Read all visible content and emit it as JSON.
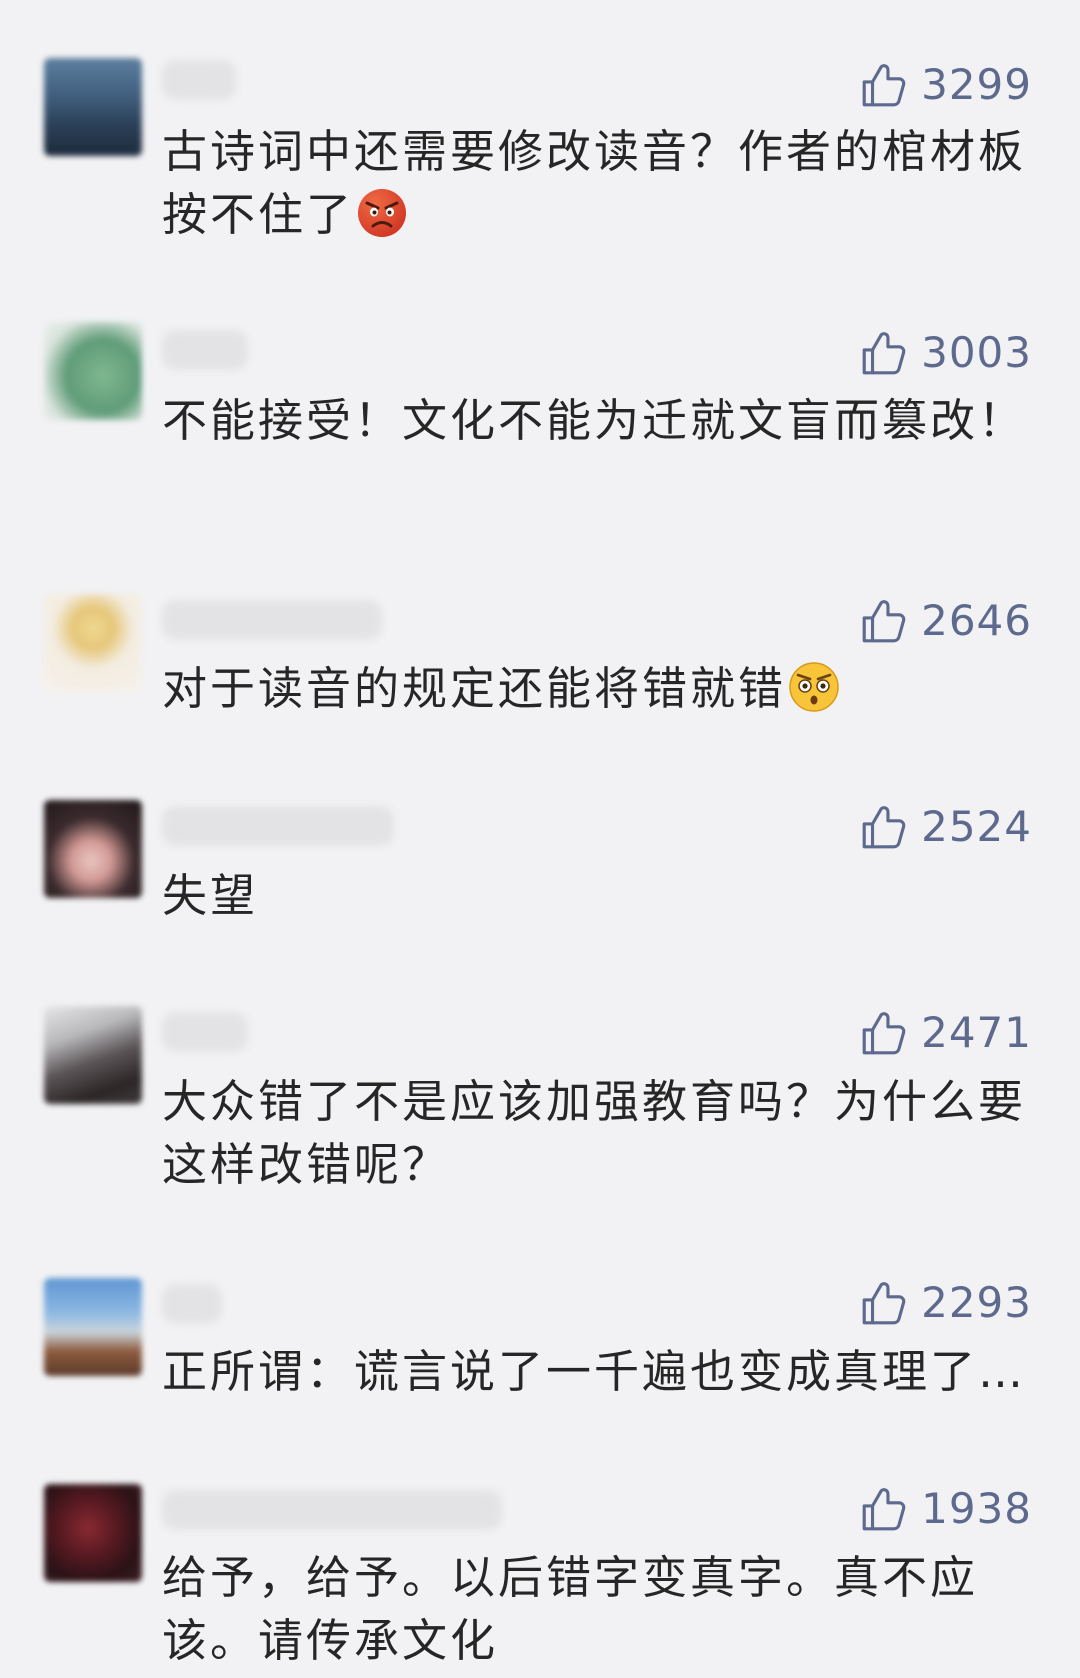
{
  "comments": [
    {
      "likes": "3299",
      "text": "古诗词中还需要修改读音？作者的棺材板按不住了",
      "emoji": "angry-face-icon"
    },
    {
      "likes": "3003",
      "text": "不能接受！文化不能为迁就文盲而篡改！"
    },
    {
      "likes": "2646",
      "text": "对于读音的规定还能将错就错",
      "emoji": "shocked-face-icon"
    },
    {
      "likes": "2524",
      "text": "失望"
    },
    {
      "likes": "2471",
      "text": "大众错了不是应该加强教育吗？为什么要这样改错呢？"
    },
    {
      "likes": "2293",
      "text": "正所谓：谎言说了一千遍也变成真理了…"
    },
    {
      "likes": "1938",
      "text": "给予，给予。以后错字变真字。真不应该。请传承文化"
    }
  ],
  "colors": {
    "background": "#f2f2f4",
    "text": "#262626",
    "likes": "#5d6a8e"
  }
}
